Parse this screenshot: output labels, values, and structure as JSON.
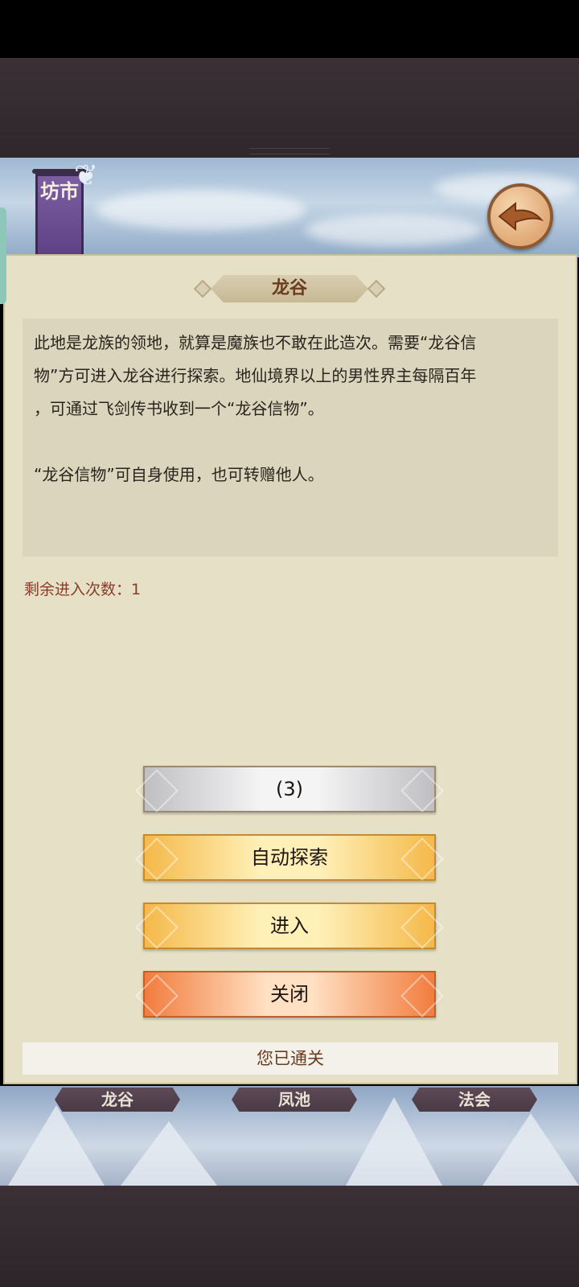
{
  "header": {
    "banner_text": "坊市",
    "back_icon": "back-arrow-icon"
  },
  "dialog": {
    "title": "龙谷",
    "description_lines": [
      "此地是龙族的领地，就算是魔族也不敢在此造次。需要“龙谷信",
      "物”方可进入龙谷进行探索。地仙境界以上的男性界主每隔百年",
      "，可通过飞剑传书收到一个“龙谷信物”。"
    ],
    "description_note": "“龙谷信物”可自身使用，也可转赠他人。",
    "remaining_entries": "剩余进入次数：1",
    "buttons": {
      "countdown": "(3)",
      "auto_explore": "自动探索",
      "enter": "进入",
      "close": "关闭"
    },
    "cleared_text": "您已通关"
  },
  "bottom_tabs": [
    "龙谷",
    "凤池",
    "法会"
  ],
  "colors": {
    "panel_bg": "#e6e0c6",
    "title_text": "#6b3b1e",
    "remain_text": "#8a3c2a",
    "gold_button": "#f5b94a",
    "close_button": "#f27c3e"
  }
}
